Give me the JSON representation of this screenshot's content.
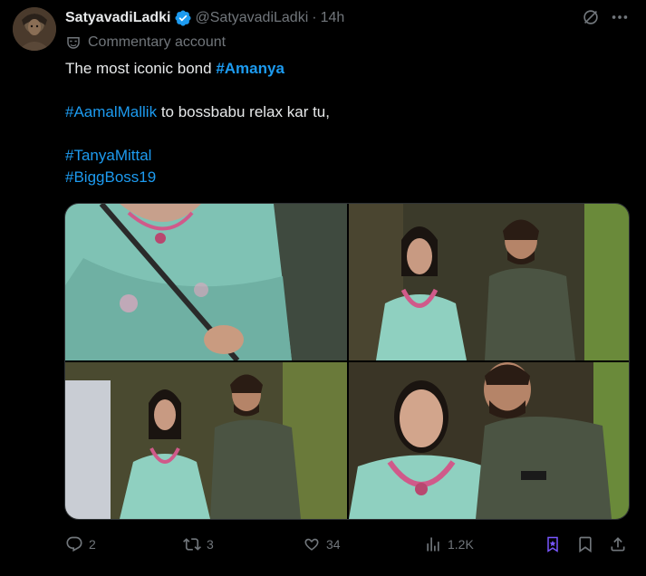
{
  "author": {
    "display_name": "SatyavadiLadki",
    "handle": "@SatyavadiLadki",
    "separator": "·",
    "time": "14h",
    "account_label": "Commentary account"
  },
  "tweet": {
    "line1_prefix": "The most iconic bond ",
    "line1_hashtag": "#Amanya",
    "line2_hashtag": "#AamalMallik",
    "line2_suffix": " to bossbabu relax kar tu,",
    "line3_hashtag": "#TanyaMittal",
    "line4_hashtag": "#BiggBoss19"
  },
  "actions": {
    "replies": "2",
    "reposts": "3",
    "likes": "34",
    "views": "1.2K"
  },
  "colors": {
    "background": "#000000",
    "text": "#e7e9ea",
    "muted": "#71767b",
    "link": "#1d9bf0",
    "grok_accent": "#7856ff"
  },
  "icons": {
    "verified": "verified-badge-icon",
    "commentary": "mask-icon",
    "grok": "grok-icon",
    "more": "more-icon",
    "reply": "reply-icon",
    "repost": "repost-icon",
    "like": "heart-icon",
    "views": "views-icon",
    "bookmark": "bookmark-icon",
    "share": "share-icon"
  }
}
